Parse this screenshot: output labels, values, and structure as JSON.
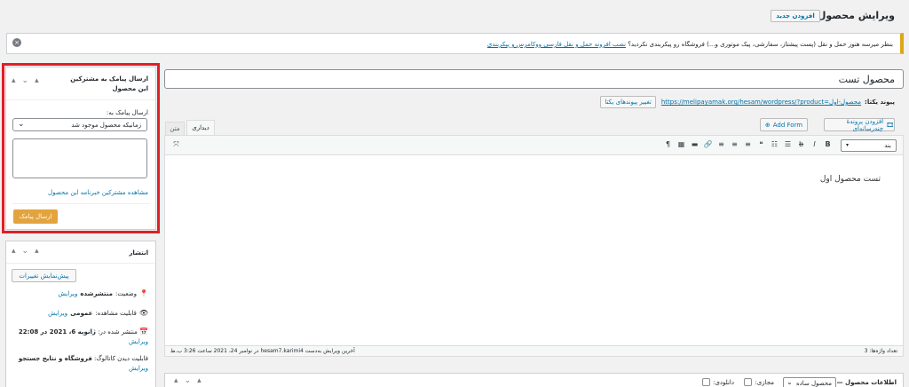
{
  "header": {
    "title": "ویرایش محصول",
    "add_new": "افزودن جدید"
  },
  "notice": {
    "text": "بنظر میرسه هنوز حمل و نقل (پست پیشتاز، سفارشی، پیک موتوری و...) فروشگاه رو پیکربندی نکردید؟",
    "link": "نصب افزونه حمل و نقل فارسی ووکامرس و پیکربندی"
  },
  "product": {
    "title": "محصول تست",
    "permalink_label": "پیوند یکتا:",
    "permalink_url": "https://melipayamak.org/hesam/wordpress/?product",
    "permalink_slug": "=محصول-اول",
    "permalink_btn": "تغییر پیوندهای یکتا"
  },
  "editor": {
    "add_media": "افزودن پروندهٔ چندرسانه‌ای",
    "add_form": "Add Form",
    "tab_visual": "دیداری",
    "tab_text": "متن",
    "format": "بند",
    "content": "تست محصول اول",
    "word_count": "تعداد واژه‌ها: 3",
    "last_edited": "آخرین ویرایش به‌دست hesam7.karimi4 در نوامبر 24، 2021 ساعت 3:26 ب.ظ"
  },
  "sms_box": {
    "title": "ارسال پیامک به مشترکین این محصول",
    "send_label": "ارسال پیامک به:",
    "select_value": "زمانیکه محصول موجود شد",
    "view_link": "مشاهده مشترکین خبرنامه این محصول",
    "send_btn": "ارسال پیامک"
  },
  "publish_box": {
    "title": "انتشار",
    "preview_btn": "پیش‌نمایش تغییرات",
    "status_label": "وضعیت:",
    "status_value": "منتشرشده",
    "visibility_label": "قابلیت مشاهده:",
    "visibility_value": "عمومی",
    "published_label": "منتشر شده در:",
    "published_value": "ژانویه 6، 2021 در 22:08",
    "catalog_label": "قابلیت دیدن کاتالوگ:",
    "catalog_value": "فروشگاه و نتایج جستجو",
    "edit": "ویرایش"
  },
  "product_data": {
    "title": "اطلاعات محصول —",
    "type_value": "محصول ساده",
    "virtual": "مجازی:",
    "downloadable": "دانلودی:"
  },
  "colors": {
    "accent": "#0073aa",
    "highlight": "#e01f26",
    "send_btn": "#e3a33d"
  }
}
